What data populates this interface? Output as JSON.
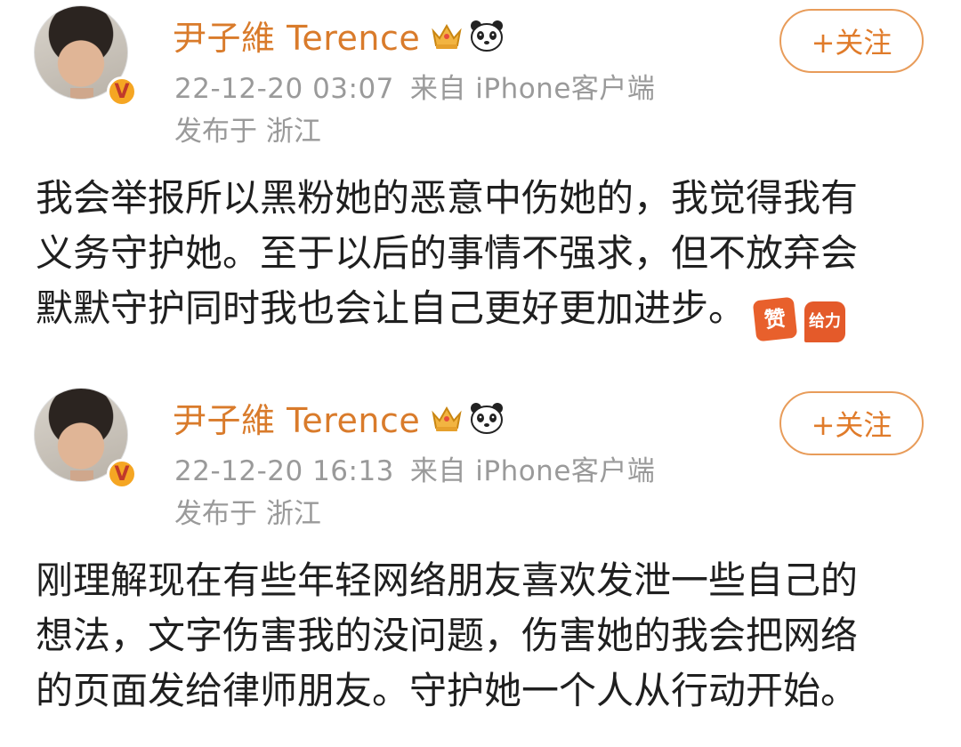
{
  "posts": [
    {
      "username": "尹子維 Terence",
      "timestamp": "22-12-20 03:07",
      "source": "来自 iPhone客户端",
      "location": "发布于 浙江",
      "follow_label": "+关注",
      "verified_badge": "V",
      "content_lines": [
        "我会举报所以黑粉她的恶意中伤她的，我觉得我有",
        "义务守护她。至于以后的事情不强求，但不放弃会",
        "默默守护同时我也会让自己更好更加进步。"
      ],
      "emojis": [
        "赞",
        "给力"
      ]
    },
    {
      "username": "尹子維 Terence",
      "timestamp": "22-12-20 16:13",
      "source": "来自 iPhone客户端",
      "location": "发布于 浙江",
      "follow_label": "+关注",
      "verified_badge": "V",
      "content_lines": [
        "刚理解现在有些年轻网络朋友喜欢发泄一些自己的",
        "想法，文字伤害我的没问题，伤害她的我会把网络",
        "的页面发给律师朋友。守护她一个人从行动开始。"
      ]
    }
  ],
  "icons": {
    "crown": "crown-icon",
    "panda": "panda-icon",
    "verified": "verified-badge-icon"
  },
  "colors": {
    "username": "#d97b2b",
    "follow_border": "#e89c5a",
    "meta_text": "#9a9a9a",
    "body_text": "#1f1f1f"
  }
}
